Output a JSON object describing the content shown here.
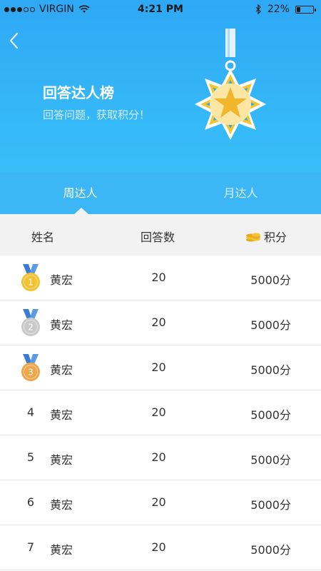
{
  "status_bar": {
    "carrier": "VIRGIN",
    "time": "4:21 PM",
    "battery": "22%",
    "battery_level": 0.22
  },
  "header": {
    "back_icon": "chevron-left-icon",
    "title": "回答达人榜",
    "subtitle": "回答问题，获取积分！",
    "medal_icon": "star-medal-icon"
  },
  "tabs": [
    {
      "label": "周达人",
      "active": true
    },
    {
      "label": "月达人",
      "active": false
    }
  ],
  "columns": {
    "name": "姓名",
    "answers": "回答数",
    "points": "积分",
    "points_icon": "coins-icon"
  },
  "rows": [
    {
      "rank": "1",
      "medal": "gold",
      "name": "黄宏",
      "answers": "20",
      "points": "5000分"
    },
    {
      "rank": "2",
      "medal": "silver",
      "name": "黄宏",
      "answers": "20",
      "points": "5000分"
    },
    {
      "rank": "3",
      "medal": "bronze",
      "name": "黄宏",
      "answers": "20",
      "points": "5000分"
    },
    {
      "rank": "4",
      "medal": "",
      "name": "黄宏",
      "answers": "20",
      "points": "5000分"
    },
    {
      "rank": "5",
      "medal": "",
      "name": "黄宏",
      "answers": "20",
      "points": "5000分"
    },
    {
      "rank": "6",
      "medal": "",
      "name": "黄宏",
      "answers": "20",
      "points": "5000分"
    },
    {
      "rank": "7",
      "medal": "",
      "name": "黄宏",
      "answers": "20",
      "points": "5000分"
    }
  ],
  "colors": {
    "header_blue": "#35b8f7",
    "gold": "#f2c232",
    "silver": "#c9c9c9",
    "bronze": "#f0a548",
    "ribbon": "#3a7bd5"
  }
}
